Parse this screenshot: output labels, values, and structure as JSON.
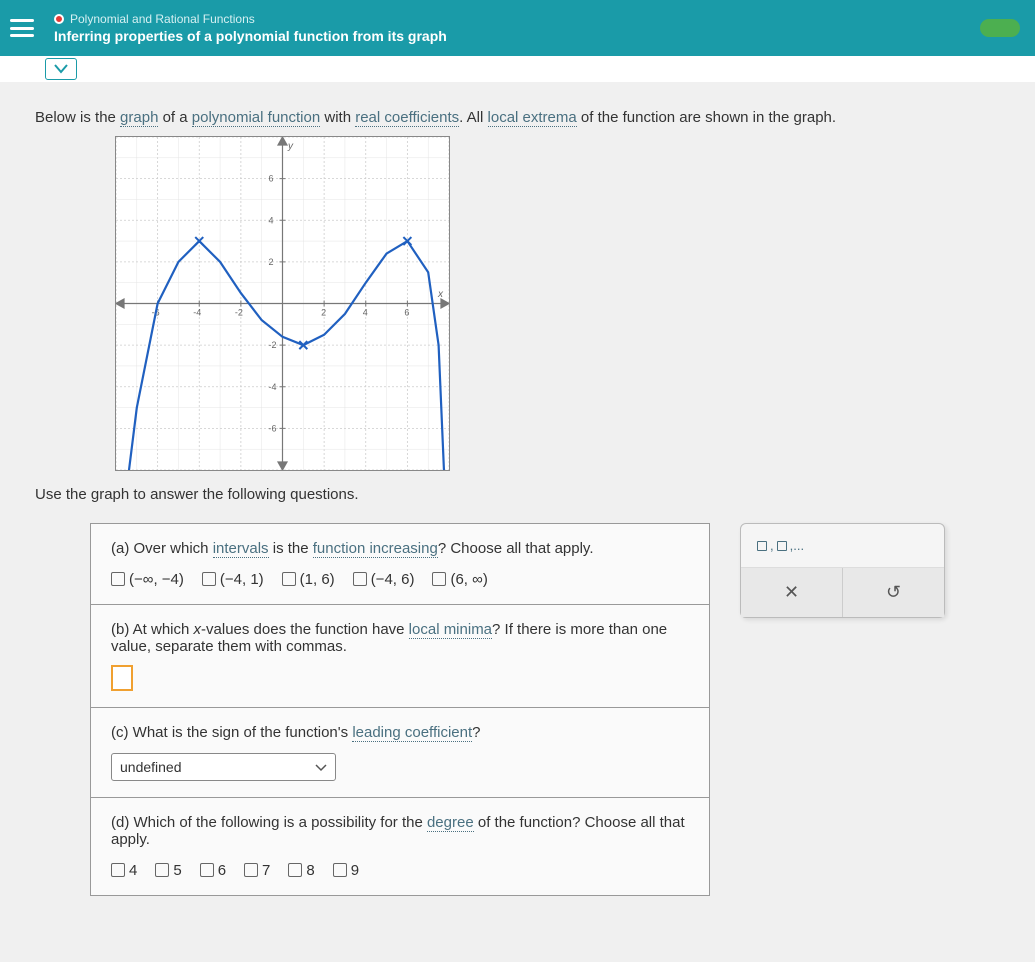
{
  "header": {
    "category": "Polynomial and Rational Functions",
    "title": "Inferring properties of a polynomial function from its graph"
  },
  "intro": {
    "pre": "Below is the ",
    "t1": "graph",
    "mid1": " of a ",
    "t2": "polynomial function",
    "mid2": " with ",
    "t3": "real coefficients",
    "mid3": ". All ",
    "t4": "local extrema",
    "post": " of the function are shown in the graph."
  },
  "instruction": "Use the graph to answer the following questions.",
  "partA": {
    "pre": "(a) Over which ",
    "t1": "intervals",
    "mid1": " is the ",
    "t2": "function increasing",
    "post": "? Choose all that apply.",
    "opts": [
      "(−∞, −4)",
      "(−4, 1)",
      "(1, 6)",
      "(−4, 6)",
      "(6, ∞)"
    ]
  },
  "partB": {
    "pre": "(b) At which ",
    "var": "x",
    "mid": "-values does the function have ",
    "t1": "local minima",
    "post": "? If there is more than one value, separate them with commas."
  },
  "partC": {
    "pre": "(c) What is the sign of the function's ",
    "t1": "leading coefficient",
    "post": "?",
    "selected": "undefined"
  },
  "partD": {
    "pre": "(d) Which of the following is a possibility for the ",
    "t1": "degree",
    "post": " of the function? Choose all that apply.",
    "opts": [
      "4",
      "5",
      "6",
      "7",
      "8",
      "9"
    ]
  },
  "tools": {
    "hint": ",...",
    "close": "✕",
    "reset": "↺"
  },
  "chart_data": {
    "type": "line",
    "title": "",
    "xlabel": "x",
    "ylabel": "y",
    "xlim": [
      -8,
      8
    ],
    "ylim": [
      -8,
      8
    ],
    "local_extrema": [
      {
        "x": -4,
        "y": 3,
        "type": "max"
      },
      {
        "x": 1,
        "y": -2,
        "type": "min"
      },
      {
        "x": 6,
        "y": 3,
        "type": "max"
      }
    ],
    "curve_points": [
      {
        "x": -7.5,
        "y": -10
      },
      {
        "x": -7,
        "y": -5
      },
      {
        "x": -6,
        "y": 0
      },
      {
        "x": -5,
        "y": 2
      },
      {
        "x": -4,
        "y": 3
      },
      {
        "x": -3,
        "y": 2
      },
      {
        "x": -2,
        "y": 0.5
      },
      {
        "x": -1,
        "y": -0.8
      },
      {
        "x": 0,
        "y": -1.6
      },
      {
        "x": 1,
        "y": -2
      },
      {
        "x": 2,
        "y": -1.5
      },
      {
        "x": 3,
        "y": -0.5
      },
      {
        "x": 4,
        "y": 1
      },
      {
        "x": 5,
        "y": 2.4
      },
      {
        "x": 6,
        "y": 3
      },
      {
        "x": 7,
        "y": 1.5
      },
      {
        "x": 7.5,
        "y": -2
      },
      {
        "x": 7.8,
        "y": -10
      }
    ]
  }
}
